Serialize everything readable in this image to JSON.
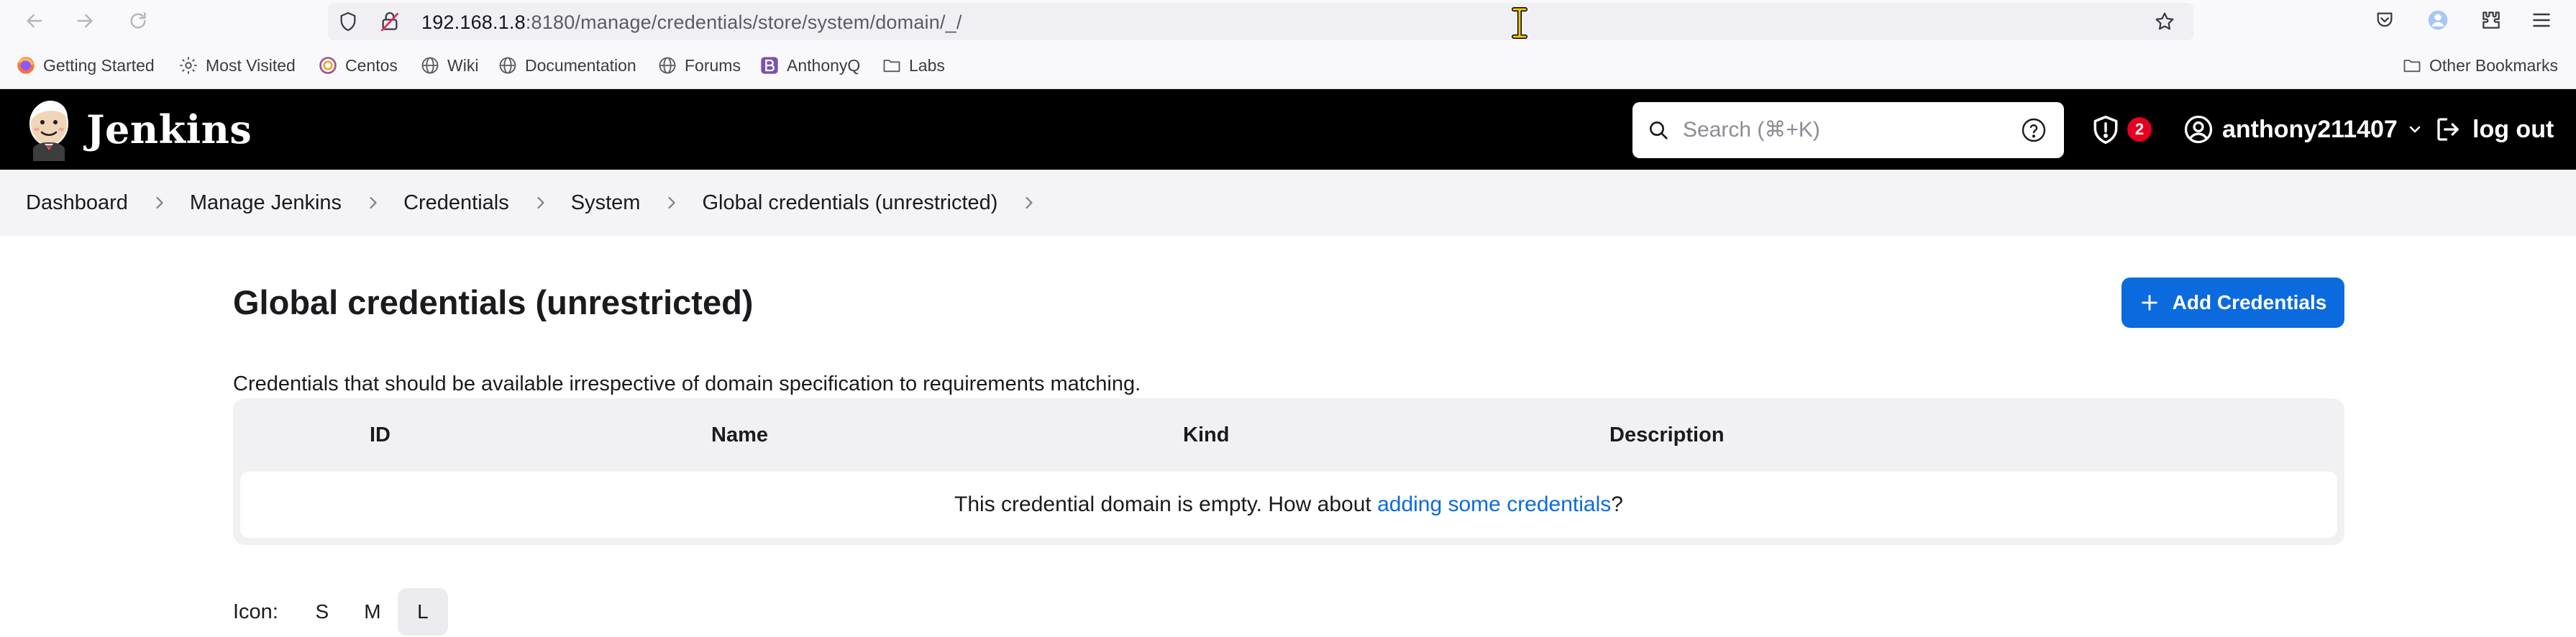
{
  "browser": {
    "url_host": "192.168.1.8",
    "url_rest": ":8180/manage/credentials/store/system/domain/_/"
  },
  "bookmarks": [
    {
      "label": "Getting Started",
      "icon": "firefox-icon"
    },
    {
      "label": "Most Visited",
      "icon": "gear-icon"
    },
    {
      "label": "Centos",
      "icon": "centos-icon"
    },
    {
      "label": "Wiki",
      "icon": "globe-icon"
    },
    {
      "label": "Documentation",
      "icon": "globe-icon"
    },
    {
      "label": "Forums",
      "icon": "globe-icon"
    },
    {
      "label": "AnthonyQ",
      "icon": "bootstrap-icon"
    },
    {
      "label": "Labs",
      "icon": "folder-icon"
    }
  ],
  "other_bookmarks": "Other Bookmarks",
  "header": {
    "brand": "Jenkins",
    "search_placeholder": "Search (⌘+K)",
    "alert_count": "2",
    "username": "anthony211407",
    "logout_label": "log out"
  },
  "breadcrumb": [
    "Dashboard",
    "Manage Jenkins",
    "Credentials",
    "System",
    "Global credentials (unrestricted)"
  ],
  "main": {
    "title": "Global credentials (unrestricted)",
    "add_button": "Add Credentials",
    "description": "Credentials that should be available irrespective of domain specification to requirements matching.",
    "columns": [
      "ID",
      "Name",
      "Kind",
      "Description"
    ],
    "empty_prefix": "This credential domain is empty. How about ",
    "empty_link": "adding some credentials",
    "empty_suffix": "?",
    "icon_label": "Icon:",
    "icon_sizes": [
      "S",
      "M",
      "L"
    ],
    "icon_size_selected": "L"
  },
  "colors": {
    "accent": "#0b6bde",
    "header_bg": "#000000",
    "badge": "#e6001f"
  }
}
